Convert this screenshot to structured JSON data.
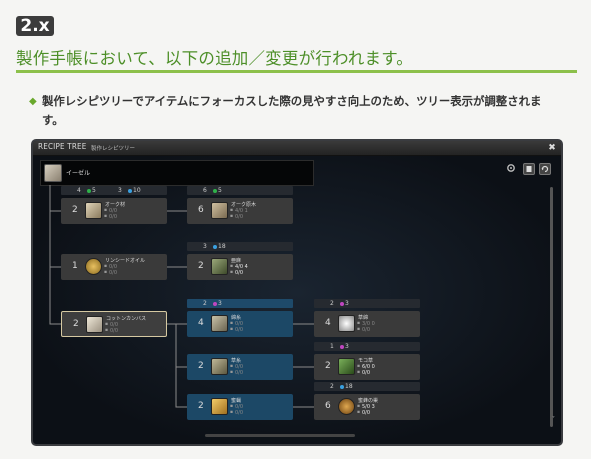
{
  "version_badge": "2.x",
  "headline": "製作手帳において、以下の追加／変更が行われます。",
  "note_bullet": "◆",
  "note": "製作レシピツリーでアイテムにフォーカスした際の見やすさ向上のため、ツリー表示が調整されます。",
  "window": {
    "title": "RECIPE TREE",
    "subtitle": "製作レシピツリー",
    "close_glyph": "✖",
    "root_label": "イーゼル",
    "toolbar_icons": [
      "settings-icon",
      "book-icon",
      "refresh-icon"
    ],
    "scroll_down_glyph": "˅"
  },
  "headers": [
    {
      "id": "h1",
      "left_num": "4",
      "left_color": "#2fb24a",
      "left_val": "5",
      "right_num": "3",
      "right_color": "#3aa0e0",
      "right_val": "10"
    },
    {
      "id": "h2",
      "left_num": "6",
      "left_color": "#2fb24a",
      "left_val": "5"
    },
    {
      "id": "h3",
      "left_num": "3",
      "left_color": "#3aa0e0",
      "left_val": "18"
    },
    {
      "id": "h4",
      "left_num": "2",
      "left_color": "#c046c0",
      "left_val": "3"
    },
    {
      "id": "h5",
      "left_num": "2",
      "left_color": "#c046c0",
      "left_val": "3"
    },
    {
      "id": "h6",
      "left_num": "1",
      "left_color": "#c046c0",
      "left_val": "3"
    },
    {
      "id": "h7",
      "left_num": "2",
      "left_color": "#3aa0e0",
      "left_val": "18"
    }
  ],
  "nodes": [
    {
      "id": "n1",
      "qty": "2",
      "name": "オーク材",
      "l1": "0/0",
      "l2": "0/0",
      "style": "grey",
      "icon": "#b8a78a"
    },
    {
      "id": "n2",
      "qty": "6",
      "name": "オーク原木",
      "l1": "4/0 1",
      "l2": "0/0",
      "style": "grey",
      "icon": "#b09a78"
    },
    {
      "id": "n3",
      "qty": "1",
      "name": "リンシードオイル",
      "l1": "0/0",
      "l2": "0/0",
      "style": "grey",
      "icon": "#c7a04a"
    },
    {
      "id": "n4",
      "qty": "2",
      "name": "亜麻",
      "l1": "4/0 4",
      "l2": "0/0",
      "style": "grey",
      "icon": "#7c8a5a",
      "bright": true
    },
    {
      "id": "n5",
      "qty": "2",
      "name": "コットンカンバス",
      "l1": "0/0",
      "l2": "0/0",
      "style": "sel",
      "icon": "#d6cfbd"
    },
    {
      "id": "n6",
      "qty": "4",
      "name": "綿糸",
      "l1": "0/0",
      "l2": "0/0",
      "style": "blue",
      "icon": "#a8a28e"
    },
    {
      "id": "n7",
      "qty": "4",
      "name": "草綿",
      "l1": "3/0 0",
      "l2": "0/0",
      "style": "grey",
      "icon": "#e0e0e0"
    },
    {
      "id": "n8",
      "qty": "2",
      "name": "草糸",
      "l1": "0/0",
      "l2": "0/0",
      "style": "blue",
      "icon": "#9c987e"
    },
    {
      "id": "n9",
      "qty": "2",
      "name": "モコ草",
      "l1": "6/0 0",
      "l2": "0/0",
      "style": "grey",
      "icon": "#4a7a3a",
      "bright": true
    },
    {
      "id": "n10",
      "qty": "2",
      "name": "蜜蝋",
      "l1": "0/0",
      "l2": "0/0",
      "style": "blue",
      "icon": "#e0b048"
    },
    {
      "id": "n11",
      "qty": "6",
      "name": "蜜蜂の巣",
      "l1": "5/0 3",
      "l2": "0/0",
      "style": "grey",
      "icon": "#c08a3a",
      "bright": true
    }
  ]
}
